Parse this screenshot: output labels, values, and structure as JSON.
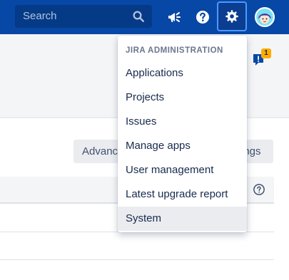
{
  "search": {
    "placeholder": "Search",
    "icon": "search-icon"
  },
  "header": {
    "announce_icon": "megaphone-icon",
    "help_icon": "question-circle-icon",
    "settings_icon": "gear-icon",
    "avatar_icon": "user-avatar"
  },
  "feedback": {
    "icon": "feedback-icon",
    "badge_count": "1"
  },
  "toolbar": {
    "advanced_label": "Advanc",
    "settings_label": "ings"
  },
  "dropdown": {
    "heading": "JIRA ADMINISTRATION",
    "items": [
      {
        "label": "Applications"
      },
      {
        "label": "Projects"
      },
      {
        "label": "Issues"
      },
      {
        "label": "Manage apps"
      },
      {
        "label": "User management"
      },
      {
        "label": "Latest upgrade report"
      },
      {
        "label": "System"
      }
    ],
    "active_item": "System"
  },
  "colors": {
    "topbar": "#0747a6",
    "accent": "#4c9aff",
    "badge": "#ffab00",
    "menu_hover": "#ebecf0"
  }
}
